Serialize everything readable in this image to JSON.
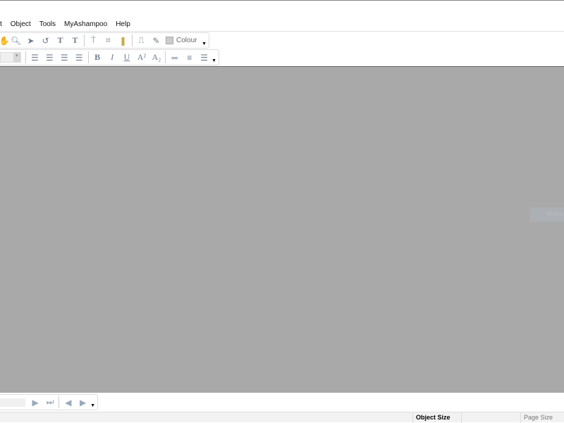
{
  "menu": [
    "t",
    "Object",
    "Tools",
    "MyAshampoo",
    "Help"
  ],
  "toolbar1": {
    "icons": [
      "hand-icon",
      "zoom-icon",
      "pointer-icon",
      "rotate-icon",
      "text-icon",
      "text-effect-icon",
      "pipette-text-icon",
      "crop-icon",
      "clip-icon",
      "curve-icon",
      "eyedropper-icon"
    ],
    "colour_label": "Colour"
  },
  "toolbar2": {
    "icons": [
      "align-left-icon",
      "align-center-icon",
      "align-right-icon",
      "justify-icon",
      "bold-icon",
      "italic-icon",
      "underline-icon",
      "superscript-icon",
      "subscript-icon",
      "line-spacing-1-icon",
      "line-spacing-2-icon",
      "line-spacing-3-icon"
    ]
  },
  "canvas": {
    "hint_text": "Reco"
  },
  "nav": {
    "icons": [
      "play-icon",
      "last-page-icon",
      "back-icon",
      "forward-icon"
    ]
  },
  "status": {
    "object_size_label": "Object Size",
    "page_size_label": "Page Size"
  }
}
